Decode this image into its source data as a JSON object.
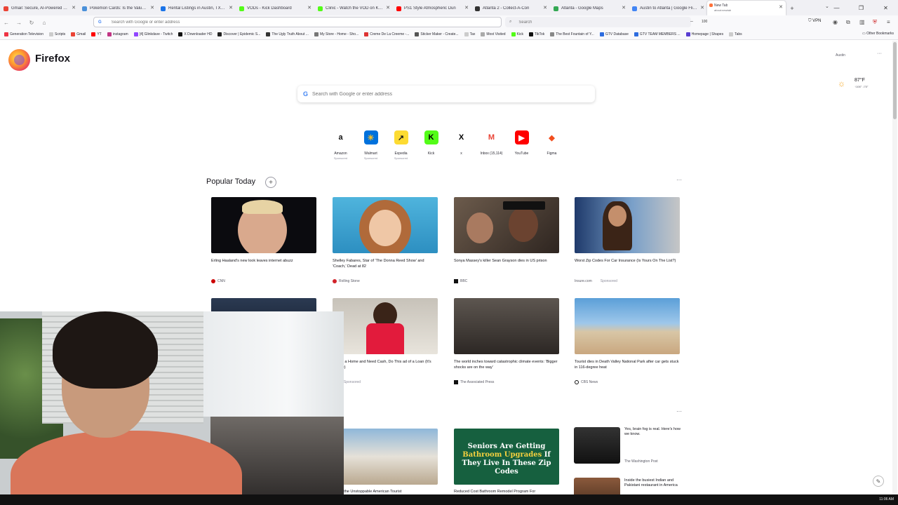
{
  "tabs": [
    {
      "label": "Gmail: Secure, AI-Powered Ema",
      "color": "#ea4335"
    },
    {
      "label": "Pokémon Cards: Is the Value Ev",
      "color": "#4a90d9"
    },
    {
      "label": "Rental Listings in Austin, TX - 17",
      "color": "#1a73e8"
    },
    {
      "label": "VODs - Kick Dashboard",
      "color": "#53fc18"
    },
    {
      "label": "Clinic - Watch the VOD on Kick",
      "color": "#53fc18"
    },
    {
      "label": "PS1 Style Atmospheric Dun",
      "color": "#ff0000"
    },
    {
      "label": "Atlanta 2 - Collect-A-Con",
      "color": "#333333"
    },
    {
      "label": "Atlanta - Google Maps",
      "color": "#34a853"
    },
    {
      "label": "Austin to Atlanta | Google Fligh",
      "color": "#4285f4"
    }
  ],
  "active_tab": {
    "label": "New Tab",
    "sub": "about:newtab",
    "color": "#ff7139"
  },
  "urlbar": {
    "placeholder": "Search with Google or enter address",
    "engine": "G"
  },
  "searchbar": {
    "placeholder": "Search"
  },
  "zoom": "100",
  "vpn_label": "VPN",
  "bookmarks": [
    {
      "label": "Generation Television",
      "color": "#e34"
    },
    {
      "label": "Scripts",
      "color": "#ccc"
    },
    {
      "label": "Gmail",
      "color": "#ea4335"
    },
    {
      "label": "YT",
      "color": "#ff0000"
    },
    {
      "label": "instagram",
      "color": "#c13584"
    },
    {
      "label": "[4] Glinkdave - Twitch",
      "color": "#9146ff"
    },
    {
      "label": "X Downloader HD",
      "color": "#111"
    },
    {
      "label": "Discover | Epidemic S...",
      "color": "#222"
    },
    {
      "label": "The Ugly Truth About ...",
      "color": "#333"
    },
    {
      "label": "My Store - Home - Sho...",
      "color": "#777"
    },
    {
      "label": "Creme De La Creeme -...",
      "color": "#d33"
    },
    {
      "label": "Sticker Maker - Create...",
      "color": "#555"
    },
    {
      "label": "Tax",
      "color": "#ccc"
    },
    {
      "label": "Most Visited",
      "color": "#aaa"
    },
    {
      "label": "Kick",
      "color": "#53fc18"
    },
    {
      "label": "TikTok",
      "color": "#111"
    },
    {
      "label": "The Best Fountain of Y...",
      "color": "#888"
    },
    {
      "label": "GTV Database",
      "color": "#2d6cdf"
    },
    {
      "label": "GTV TEAM MEMBERS ...",
      "color": "#2d6cdf"
    },
    {
      "label": "Homepage | Shapes",
      "color": "#5a3fd1"
    },
    {
      "label": "Tabs",
      "color": "#ccc"
    }
  ],
  "other_bookmarks": "Other Bookmarks",
  "brand": "Firefox",
  "weather": {
    "city": "Austin",
    "temp": "87°F",
    "range": "↑106° ↓75°"
  },
  "newtab_search": {
    "placeholder": "Search with Google or enter address"
  },
  "shortcuts": [
    {
      "name": "Amazon",
      "sub": "Sponsored",
      "glyph": "a",
      "bg": "#ffffff",
      "fg": "#111111"
    },
    {
      "name": "Walmart",
      "sub": "Sponsored",
      "glyph": "✳",
      "bg": "#0071dc",
      "fg": "#ffc220"
    },
    {
      "name": "Expedia",
      "sub": "Sponsored",
      "glyph": "↗",
      "bg": "#fddb32",
      "fg": "#1a1a1a"
    },
    {
      "name": "Kick",
      "sub": "",
      "glyph": "K",
      "bg": "#53fc18",
      "fg": "#000000"
    },
    {
      "name": "x",
      "sub": "",
      "glyph": "X",
      "bg": "#ffffff",
      "fg": "#000000"
    },
    {
      "name": "Inbox (15,114)",
      "sub": "",
      "glyph": "M",
      "bg": "#ffffff",
      "fg": "#ea4335"
    },
    {
      "name": "YouTube",
      "sub": "",
      "glyph": "▶",
      "bg": "#ff0000",
      "fg": "#ffffff"
    },
    {
      "name": "Figma",
      "sub": "",
      "glyph": "◆",
      "bg": "#ffffff",
      "fg": "#f24e1e"
    }
  ],
  "popular": {
    "title": "Popular Today"
  },
  "cards_row1": [
    {
      "headline": "Erling Haaland's new look leaves internet abuzz",
      "source": "CNN",
      "sponsored": "",
      "src_color": "#cc0000"
    },
    {
      "headline": "Shelley Fabares, Star of 'The Donna Reed Show' and 'Coach,' Dead at 82",
      "source": "Rolling Stone",
      "sponsored": "",
      "src_color": "#d2232a"
    },
    {
      "headline": "Sonya Massey's killer Sean Grayson dies in US prison",
      "source": "BBC",
      "sponsored": "",
      "src_color": "#111111"
    },
    {
      "headline": "Worst Zip Codes For Car Insurance (Is Yours On The List?)",
      "source": "Insure.com",
      "sponsored": "Sponsored",
      "src_color": "#ffffff"
    }
  ],
  "cards_row2": [
    {
      "headline": "o Own a Home and Need Cash, Do This ad of a Loan (It's Simple)",
      "source": "lo",
      "sponsored": "Sponsored",
      "src_color": "#ffffff"
    },
    {
      "headline": "The world inches toward catastrophic climate events: 'Bigger shocks are on the way'",
      "source": "The Associated Press",
      "sponsored": "",
      "src_color": "#111111"
    },
    {
      "headline": "Tourist dies in Death Valley National Park after car gets stuck in 116-degree heat",
      "source": "CBS News",
      "sponsored": "",
      "src_color": "#1a1a1a"
    }
  ],
  "cards_row3": [
    {
      "headline": "line of the Unstoppable American Tourist"
    },
    {
      "headline": "Reduced Cost Bathroom Remodel Program For"
    }
  ],
  "bath_ad": {
    "line1": "Seniors Are Getting",
    "line2": "Bathroom Upgrades",
    "line3": " If They Live In These Zip Codes"
  },
  "minis": [
    {
      "headline": "Yes, brain fog is real. Here's how we know.",
      "source": "The Washington Post"
    },
    {
      "headline": "Inside the busiest Indian and Pakistani restaurant in America",
      "source": ""
    }
  ],
  "clock": "11:06 AM"
}
